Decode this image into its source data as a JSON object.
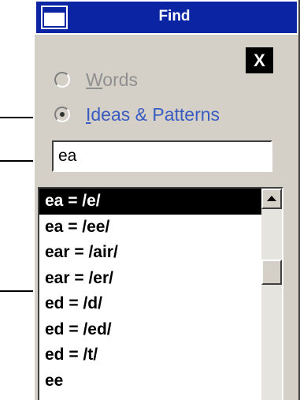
{
  "window": {
    "title": "Find",
    "close_label": "X"
  },
  "search_mode": {
    "options": [
      {
        "prefix": "",
        "underlined": "W",
        "rest": "ords",
        "enabled": false,
        "checked": false
      },
      {
        "prefix": "",
        "underlined": "I",
        "rest": "deas & Patterns",
        "enabled": true,
        "checked": true
      }
    ]
  },
  "search": {
    "value": "ea"
  },
  "results": {
    "items": [
      "ea = /e/",
      "ea = /ee/",
      "ear = /air/",
      "ear = /er/",
      "ed = /d/",
      "ed = /ed/",
      "ed = /t/",
      "ee"
    ],
    "selected_index": 0
  },
  "colors": {
    "titlebar": "#0a24a4",
    "window_bg": "#d4d0c8",
    "active_option": "#3a5cc0",
    "disabled_option": "#909090"
  },
  "icons": {
    "window": "window-icon",
    "close": "close-icon",
    "scroll_up": "arrow-up-icon"
  }
}
